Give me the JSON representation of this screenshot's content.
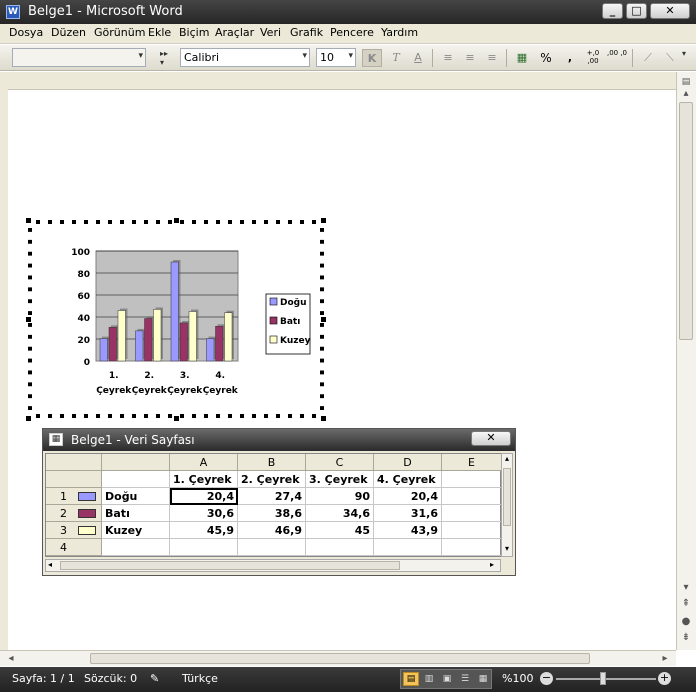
{
  "window": {
    "title": "Belge1 - Microsoft Word",
    "app_icon": "W"
  },
  "menu": [
    "Dosya",
    "Düzen",
    "Görünüm",
    "Ekle",
    "Biçim",
    "Araçlar",
    "Veri",
    "Grafik",
    "Pencere",
    "Yardım"
  ],
  "toolbar": {
    "font_name": "Calibri",
    "font_size": "10",
    "bold": "K",
    "italic": "T",
    "underline": "A",
    "percent": "%",
    "comma": ",",
    "inc_decimal": "+,0 ,00",
    "dec_decimal": ",00 ,0"
  },
  "chart_data": {
    "type": "bar",
    "categories": [
      "1. Çeyrek",
      "2. Çeyrek",
      "3. Çeyrek",
      "4. Çeyrek"
    ],
    "series": [
      {
        "name": "Doğu",
        "values": [
          20.4,
          27.4,
          90,
          20.4
        ],
        "color": "#9999ff"
      },
      {
        "name": "Batı",
        "values": [
          30.6,
          38.6,
          34.6,
          31.6
        ],
        "color": "#993366"
      },
      {
        "name": "Kuzey",
        "values": [
          45.9,
          46.9,
          45,
          43.9
        ],
        "color": "#ffffcc"
      }
    ],
    "y_ticks": [
      "0",
      "20",
      "40",
      "60",
      "80",
      "100"
    ],
    "ylim": [
      0,
      100
    ],
    "grid": true,
    "legend": "right"
  },
  "datasheet": {
    "title": "Belge1 - Veri Sayfası",
    "columns": [
      "A",
      "B",
      "C",
      "D",
      "E"
    ],
    "col_headers": [
      "1. Çeyrek",
      "2. Çeyrek",
      "3. Çeyrek",
      "4. Çeyrek",
      ""
    ],
    "rows": [
      {
        "num": "1",
        "label": "Doğu",
        "values": [
          "20,4",
          "27,4",
          "90",
          "20,4",
          ""
        ]
      },
      {
        "num": "2",
        "label": "Batı",
        "values": [
          "30,6",
          "38,6",
          "34,6",
          "31,6",
          ""
        ]
      },
      {
        "num": "3",
        "label": "Kuzey",
        "values": [
          "45,9",
          "46,9",
          "45",
          "43,9",
          ""
        ]
      },
      {
        "num": "4",
        "label": "",
        "values": [
          "",
          "",
          "",
          "",
          ""
        ]
      }
    ]
  },
  "status": {
    "page": "Sayfa: 1 / 1",
    "words": "Sözcük: 0",
    "language": "Türkçe",
    "zoom": "%100"
  }
}
